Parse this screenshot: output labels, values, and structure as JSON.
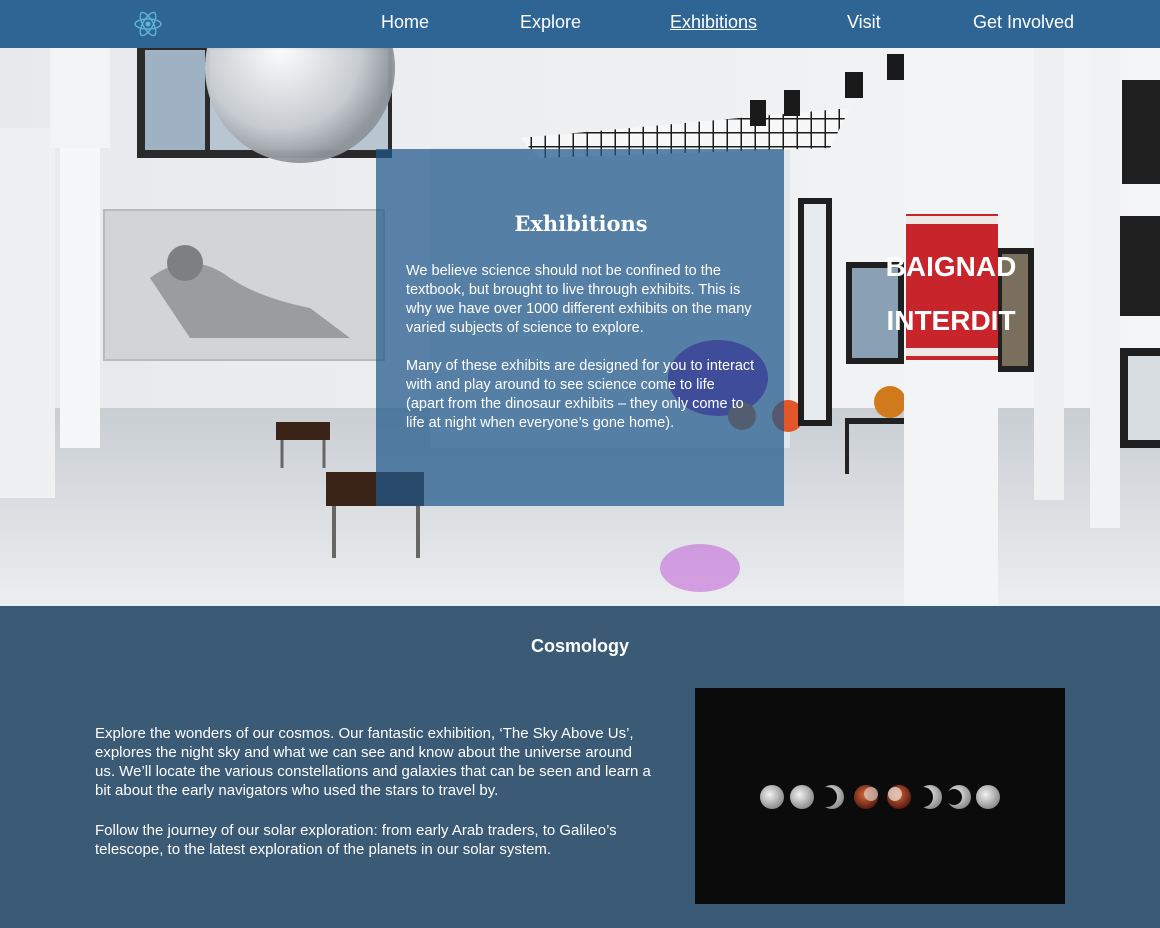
{
  "nav": {
    "logo_icon": "atom-icon",
    "items": [
      {
        "label": "Home"
      },
      {
        "label": "Explore"
      },
      {
        "label": "Exhibitions",
        "active": true
      },
      {
        "label": "Visit"
      },
      {
        "label": "Get Involved"
      }
    ]
  },
  "hero": {
    "title": "Exhibitions",
    "paragraphs": [
      "We believe science should not be confined to the textbook, but brought to live through exhibits. This is why we have over 1000 different exhibits on the many varied subjects of science to explore.",
      "Many of these exhibits are designed for you to interact with and play around to see science come to life (apart from the dinosaur exhibits – they only come to life at night when everyone’s gone home)."
    ],
    "sign_text": [
      "BAIGNAD",
      "INTERDIT"
    ]
  },
  "cosmology": {
    "title": "Cosmology",
    "paragraphs": [
      "Explore the wonders of our cosmos. Our fantastic exhibition, ‘The Sky Above Us’, explores the night sky and what we can see and know about the universe around us. We’ll locate the various constellations and galaxies that can be seen and learn a bit about the early navigators who used the stars to travel by.",
      "Follow the journey of our solar exploration: from early Arab traders, to Galileo’s telescope, to the latest exploration of the planets in our solar system."
    ]
  },
  "colors": {
    "nav_bg": "#2f6594",
    "section_bg": "#3a5a76",
    "card_bg": "#20588a",
    "sign_red": "#c8242b"
  }
}
